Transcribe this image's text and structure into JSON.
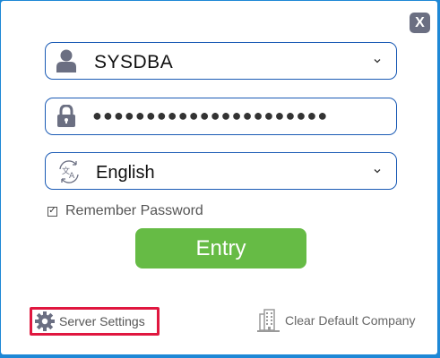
{
  "dialog": {
    "close_label": "X"
  },
  "user": {
    "value": "SYSDBA",
    "icon": "user-icon"
  },
  "password": {
    "masked_value": "●●●●●●●●●●●●●●●●●●●●●●",
    "icon": "lock-icon"
  },
  "language": {
    "value": "English",
    "icon": "translate-icon"
  },
  "remember": {
    "label": "Remember Password",
    "checked": true,
    "check_glyph": "✓"
  },
  "entry": {
    "label": "Entry",
    "color": "#66bb45"
  },
  "footer": {
    "server_settings_label": "Server Settings",
    "server_settings_icon": "gear-icon",
    "clear_company_label": "Clear Default Company",
    "clear_company_icon": "building-icon",
    "highlight_color": "#e0173f"
  },
  "colors": {
    "field_border": "#1b5bb5",
    "icon_gray": "#6b6f82",
    "background": "#1e88d6"
  }
}
